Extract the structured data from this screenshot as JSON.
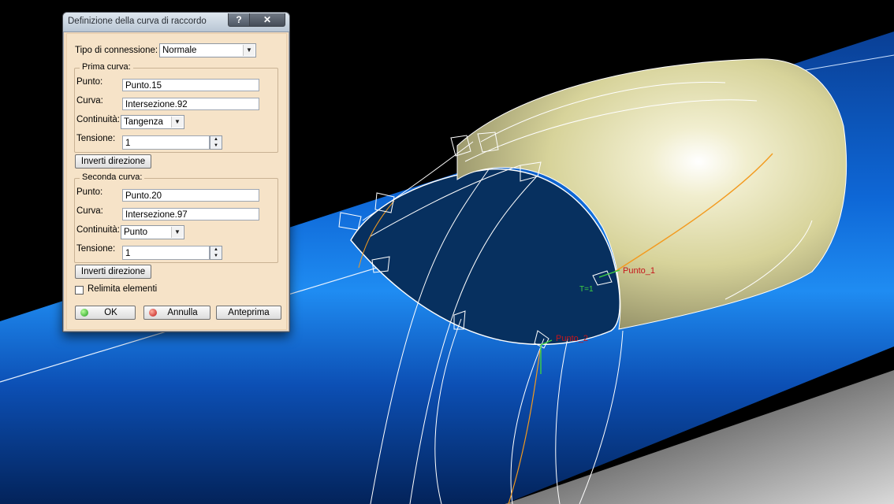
{
  "dialog": {
    "title": "Definizione della curva di raccordo",
    "help_label": "?",
    "close_label": "✕",
    "connection_type": {
      "label": "Tipo di connessione:",
      "value": "Normale"
    },
    "first_curve": {
      "group_title": "Prima curva:",
      "point_label": "Punto:",
      "point_value": "Punto.15",
      "curve_label": "Curva:",
      "curve_value": "Intersezione.92",
      "continuity_label": "Continuità:",
      "continuity_value": "Tangenza",
      "tension_label": "Tensione:",
      "tension_value": "1"
    },
    "invert_direction_1": "Inverti direzione",
    "second_curve": {
      "group_title": "Seconda curva:",
      "point_label": "Punto:",
      "point_value": "Punto.20",
      "curve_label": "Curva:",
      "curve_value": "Intersezione.97",
      "continuity_label": "Continuità:",
      "continuity_value": "Punto",
      "tension_label": "Tensione:",
      "tension_value": "1"
    },
    "invert_direction_2": "Inverti direzione",
    "trim_elements": {
      "label": "Relimita elementi",
      "checked": false
    },
    "ok_label": "OK",
    "cancel_label": "Annulla",
    "preview_label": "Anteprima"
  },
  "viewport": {
    "point_1_label": "Punto_1",
    "point_2_label": "Punto_2",
    "tangent_label": "T=1",
    "colors": {
      "tube_blue": "#0b56b8",
      "surface": "#e6e2a8",
      "background": "#000000",
      "curve_orange": "#f39a1e",
      "label_red": "#c6161b",
      "axis_green": "#3fd141"
    }
  }
}
